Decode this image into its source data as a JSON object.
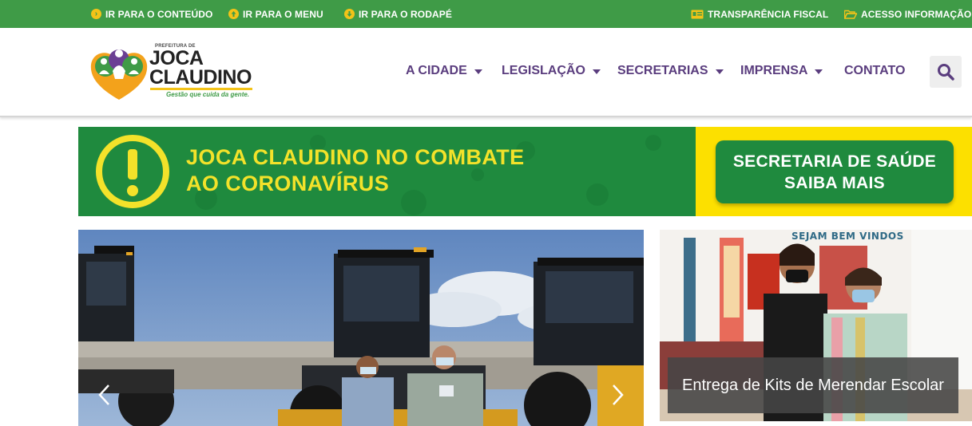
{
  "topbar": {
    "skip_content": "IR PARA O CONTEÚDO",
    "skip_menu": "IR PARA O MENU",
    "skip_footer": "IR PARA O RODAPÉ",
    "transparency": "TRANSPARÊNCIA FISCAL",
    "access_info": "ACESSO INFORMAÇÃO"
  },
  "logo": {
    "prefix": "PREFEITURA DE",
    "line1": "JOCA",
    "line2": "CLAUDINO",
    "tagline": "Gestão que cuida da gente."
  },
  "nav": {
    "items": [
      {
        "label": "A CIDADE"
      },
      {
        "label": "LEGISLAÇÃO"
      },
      {
        "label": "SECRETARIAS"
      },
      {
        "label": "IMPRENSA"
      },
      {
        "label": "CONTATO"
      }
    ]
  },
  "banner": {
    "line1": "JOCA CLAUDINO NO COMBATE",
    "line2": "AO CORONAVÍRUS",
    "cta_line1": "SECRETARIA DE SAÚDE",
    "cta_line2": "SAIBA MAIS"
  },
  "side_news": {
    "caption": "Entrega de Kits de Merendar Escolar",
    "sign": "SEJAM BEM VINDOS"
  },
  "colors": {
    "green": "#3f9b47",
    "yellow": "#f3c318",
    "purple": "#5a3d7e",
    "banner_green": "#1f8a3e",
    "banner_yellow": "#fce000"
  },
  "icons": {
    "skip_content": "arrow-right-circle-icon",
    "skip_menu": "arrow-up-circle-icon",
    "skip_footer": "arrow-down-circle-icon",
    "transparency": "id-card-icon",
    "access_info": "folder-open-icon",
    "search": "search-icon",
    "slider_prev": "chevron-left-icon",
    "slider_next": "chevron-right-icon"
  }
}
